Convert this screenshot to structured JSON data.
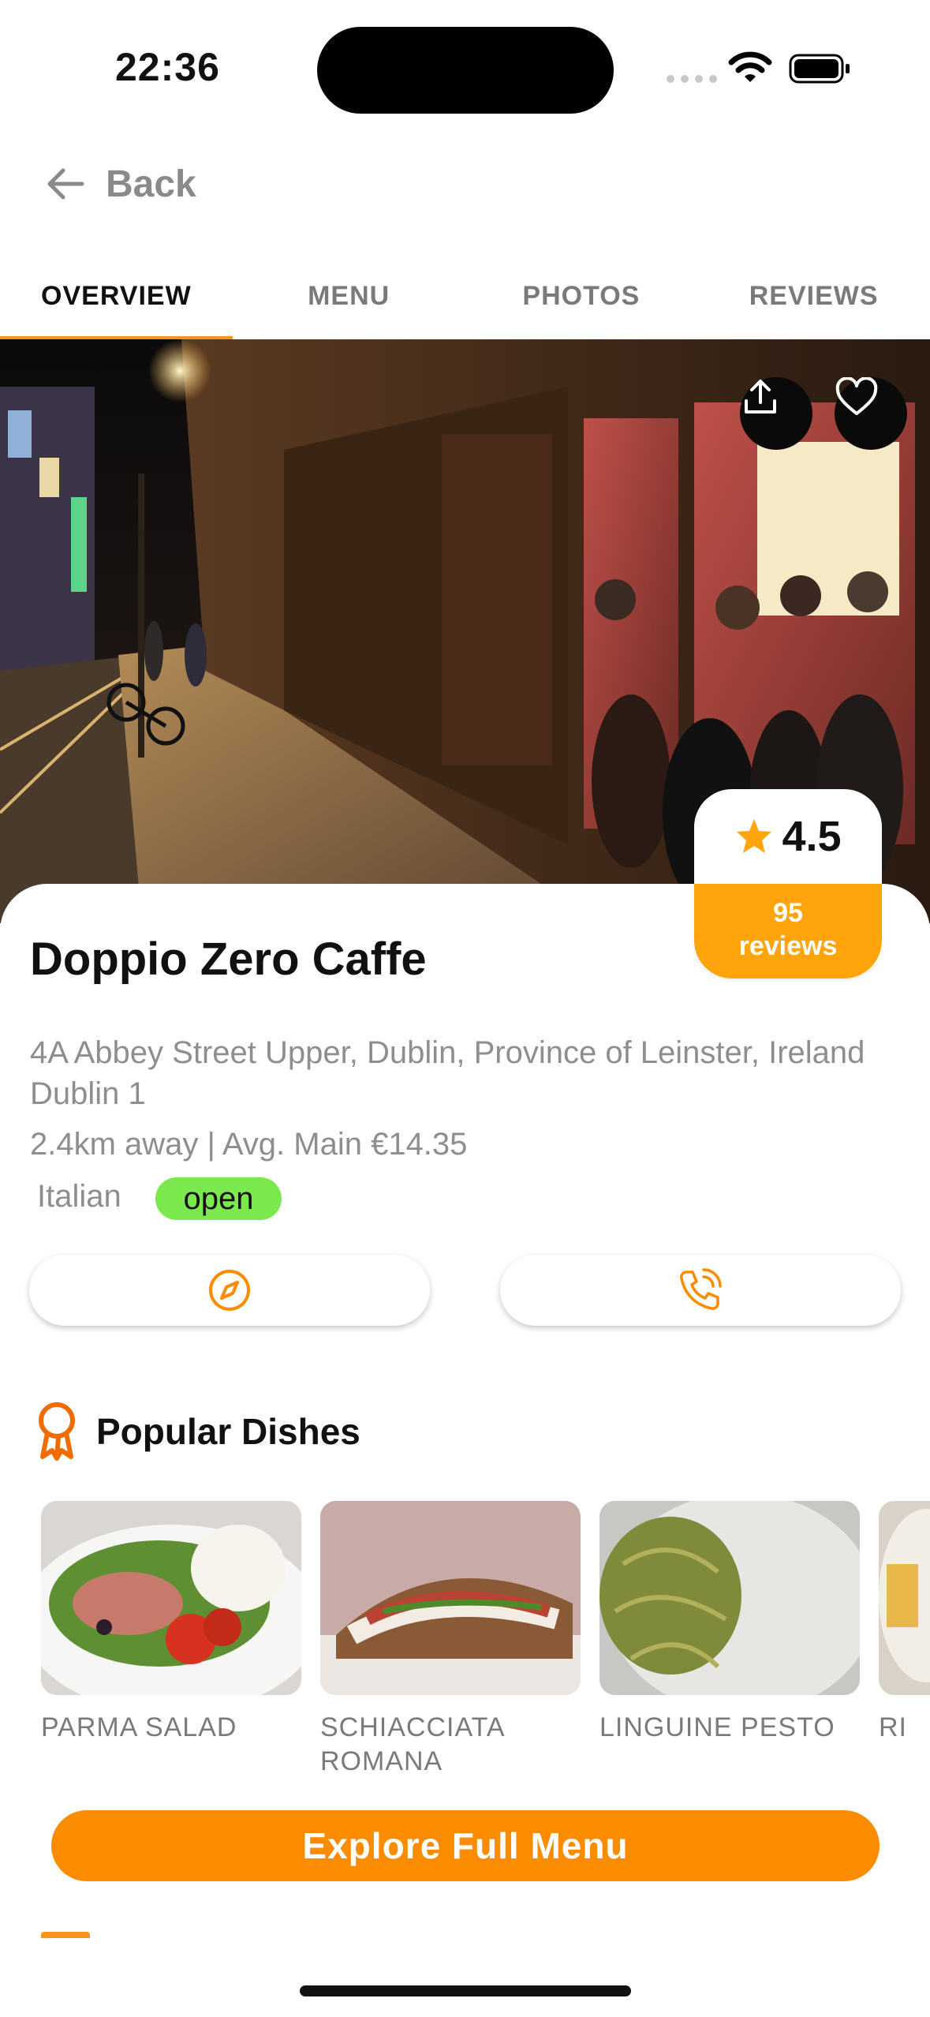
{
  "status_bar": {
    "time": "22:36"
  },
  "nav": {
    "back_label": "Back"
  },
  "tabs": [
    {
      "label": "OVERVIEW",
      "active": true
    },
    {
      "label": "MENU",
      "active": false
    },
    {
      "label": "PHOTOS",
      "active": false
    },
    {
      "label": "REVIEWS",
      "active": false
    }
  ],
  "restaurant": {
    "name": "Doppio Zero Caffe",
    "address": "4A Abbey Street Upper, Dublin, Province of Leinster, Ireland Dublin 1",
    "distance": "2.4km away |",
    "avg_main": "Avg. Main €14.35",
    "cuisine": "Italian",
    "status": "open",
    "rating": "4.5",
    "reviews_count": "95",
    "reviews_label": "reviews"
  },
  "actions": {
    "directions_icon": "compass-icon",
    "call_icon": "phone-icon"
  },
  "popular_dishes": {
    "title": "Popular Dishes",
    "items": [
      {
        "name": "PARMA SALAD"
      },
      {
        "name": "SCHIACCIATA ROMANA"
      },
      {
        "name": "LINGUINE PESTO"
      },
      {
        "name": "RI"
      }
    ]
  },
  "cta": {
    "label": "Explore Full Menu"
  },
  "colors": {
    "accent": "#fb8c00",
    "rating_bg": "#ffa50b",
    "open_badge": "#7be84d",
    "star": "#ffa50b"
  }
}
